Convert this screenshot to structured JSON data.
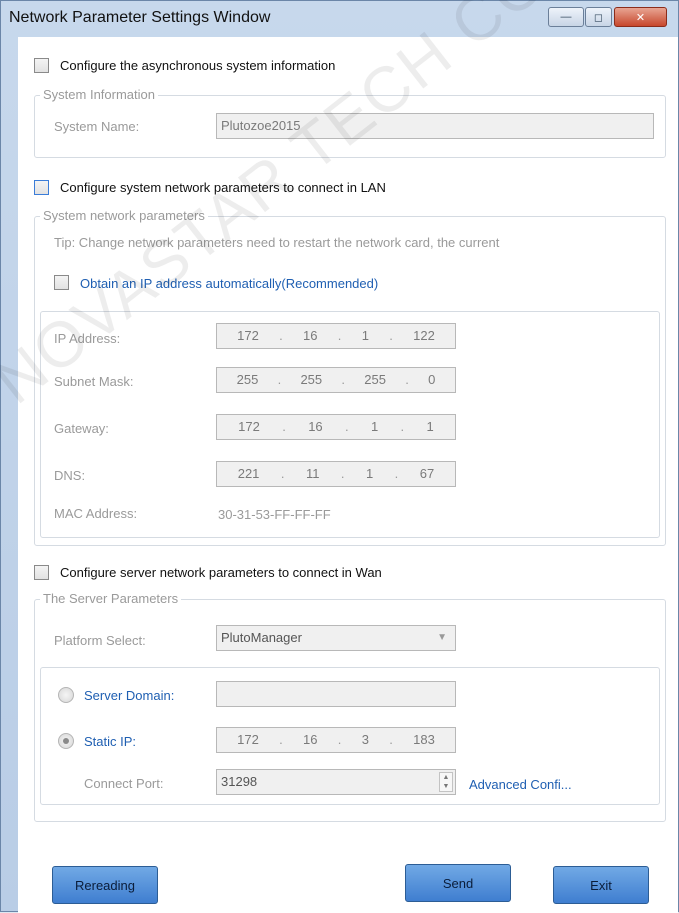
{
  "window": {
    "title": "Network Parameter Settings Window",
    "buttons": {
      "minimize": "—",
      "maximize": "◻",
      "close": "✕"
    }
  },
  "async_section": {
    "checkbox_label": "Configure the asynchronous system information",
    "group_title": "System Information",
    "system_name_label": "System Name:",
    "system_name_value": "Plutozoe2015"
  },
  "lan_section": {
    "checkbox_label": "Configure system network parameters to connect in LAN",
    "group_title": "System network parameters",
    "tip": "Tip: Change network parameters need to restart the network card, the current",
    "auto_ip_label": "Obtain an IP address automatically(Recommended)",
    "ip_label": "IP Address:",
    "ip_value": [
      "172",
      "16",
      "1",
      "122"
    ],
    "mask_label": "Subnet Mask:",
    "mask_value": [
      "255",
      "255",
      "255",
      "0"
    ],
    "gateway_label": "Gateway:",
    "gateway_value": [
      "172",
      "16",
      "1",
      "1"
    ],
    "dns_label": "DNS:",
    "dns_value": [
      "221",
      "11",
      "1",
      "67"
    ],
    "mac_label": "MAC Address:",
    "mac_value": "30-31-53-FF-FF-FF"
  },
  "wan_section": {
    "checkbox_label": "Configure server network parameters to connect in Wan",
    "group_title": "The Server Parameters",
    "platform_label": "Platform Select:",
    "platform_value": "PlutoManager",
    "server_domain_label": "Server Domain:",
    "server_domain_value": "",
    "static_ip_label": "Static IP:",
    "static_ip_value": [
      "172",
      "16",
      "3",
      "183"
    ],
    "port_label": "Connect Port:",
    "port_value": "31298",
    "advanced_link": "Advanced Confi..."
  },
  "footer": {
    "rereading": "Rereading",
    "send": "Send",
    "exit": "Exit"
  },
  "watermark": "NOVASTAR TECH CO"
}
